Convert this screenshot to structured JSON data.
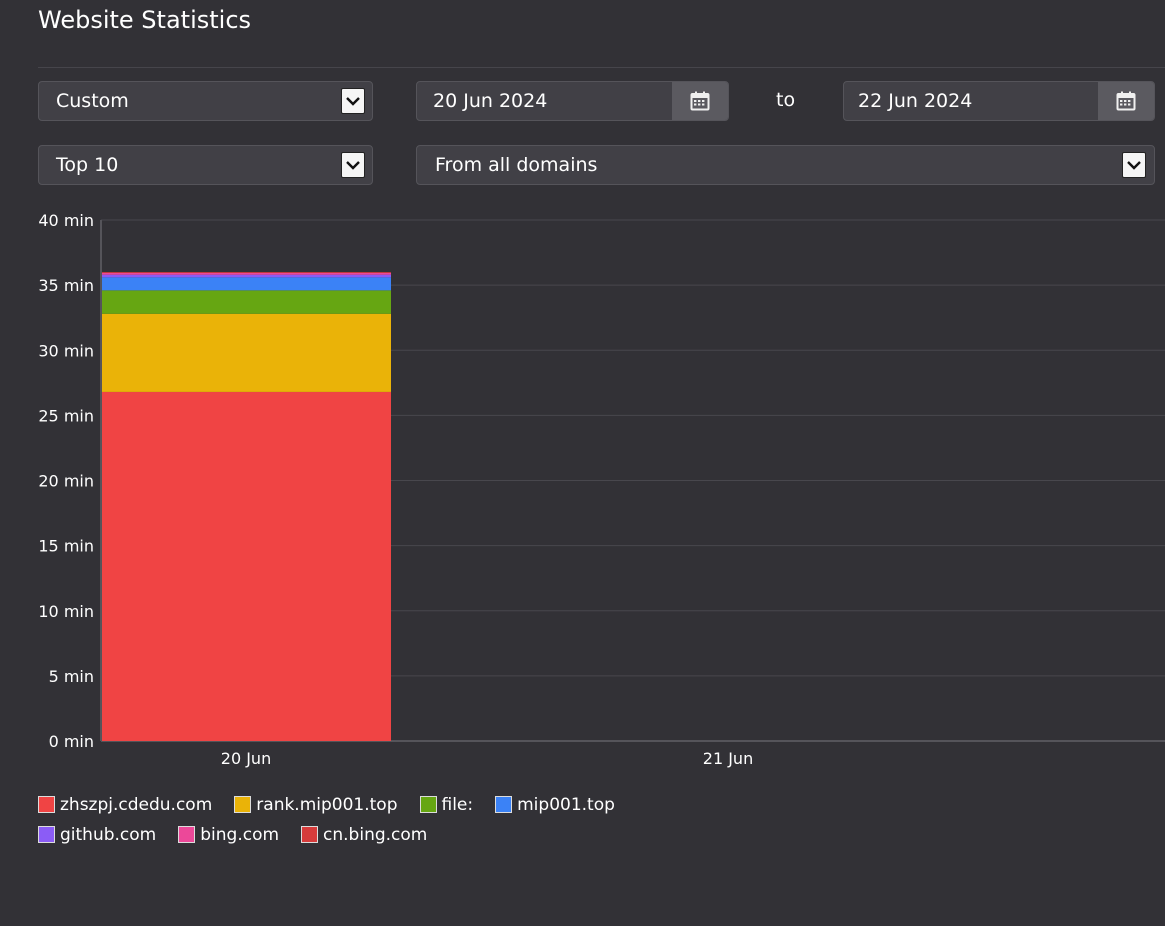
{
  "page": {
    "title": "Website Statistics"
  },
  "filters": {
    "range": "Custom",
    "from_date": "20 Jun 2024",
    "to_label": "to",
    "to_date": "22 Jun 2024",
    "top": "Top 10",
    "domains": "From all domains"
  },
  "icons": {
    "dropdown": "chevron-down-icon",
    "calendar": "calendar-icon"
  },
  "chart_data": {
    "type": "bar",
    "stacked": true,
    "categories": [
      "20 Jun",
      "21 Jun"
    ],
    "ylim": [
      0,
      40
    ],
    "yticks": [
      0,
      5,
      10,
      15,
      20,
      25,
      30,
      35,
      40
    ],
    "y_unit": "min",
    "grid": true,
    "legend_position": "bottom-left",
    "series": [
      {
        "name": "zhszpj.cdedu.com",
        "color": "#f04444",
        "values": [
          26.8,
          0
        ]
      },
      {
        "name": "rank.mip001.top",
        "color": "#eab308",
        "values": [
          6.0,
          0
        ]
      },
      {
        "name": "file:",
        "color": "#66a612",
        "values": [
          1.8,
          0
        ]
      },
      {
        "name": "mip001.top",
        "color": "#3b82f6",
        "values": [
          1.0,
          0
        ]
      },
      {
        "name": "github.com",
        "color": "#8b5cf6",
        "values": [
          0.2,
          0
        ]
      },
      {
        "name": "bing.com",
        "color": "#ec4899",
        "values": [
          0.15,
          0
        ]
      },
      {
        "name": "cn.bing.com",
        "color": "#d63b3b",
        "values": [
          0.05,
          0
        ]
      }
    ]
  }
}
